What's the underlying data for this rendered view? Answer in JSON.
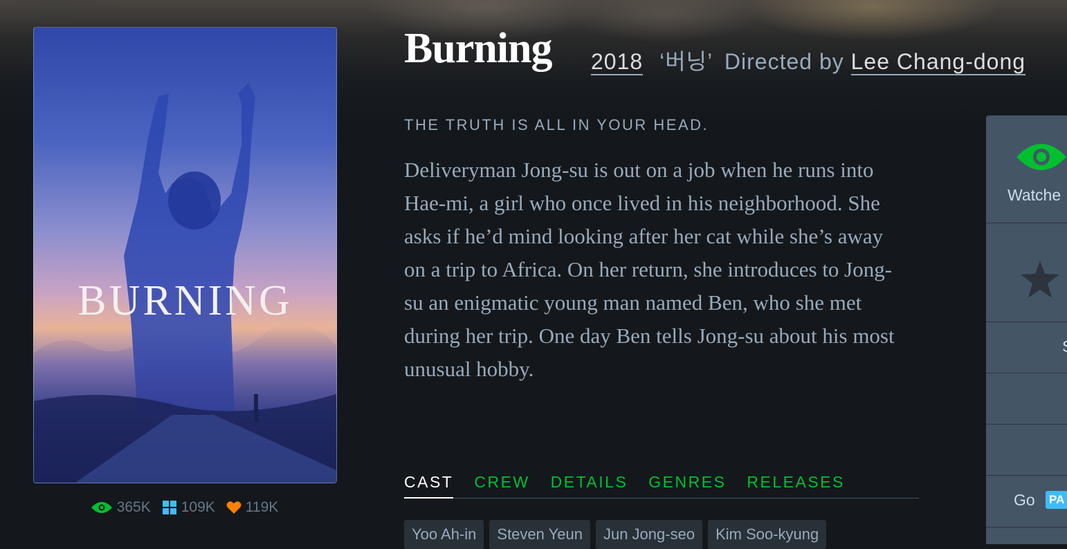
{
  "film": {
    "title": "Burning",
    "year": "2018",
    "original_title": "‘버닝’",
    "directed_by": "Directed by",
    "director": "Lee Chang-dong",
    "tagline": "THE TRUTH IS ALL IN YOUR HEAD.",
    "synopsis": "Deliveryman Jong-su is out on a job when he runs into Hae-mi, a girl who once lived in his neighborhood. She asks if he’d mind looking after her cat while she’s away on a trip to Africa. On her return, she introduces to Jong-su an enigmatic young man named Ben, who she met during her trip. One day Ben tells Jong-su about his most unusual hobby."
  },
  "poster": {
    "text": "BURNING"
  },
  "stats": {
    "watched": "365K",
    "lists": "109K",
    "likes": "119K"
  },
  "colors": {
    "green": "#00c030",
    "blue": "#40bcf4",
    "orange": "#ff8000"
  },
  "tabs": [
    "CAST",
    "CREW",
    "DETAILS",
    "GENRES",
    "RELEASES"
  ],
  "cast": [
    "Yoo Ah-in",
    "Steven Yeun",
    "Jun Jong-seo",
    "Kim Soo-kyung"
  ],
  "panel": {
    "watched_label": "Watche",
    "cell3_text": "S",
    "go_label": "Go",
    "badge": "PA"
  }
}
